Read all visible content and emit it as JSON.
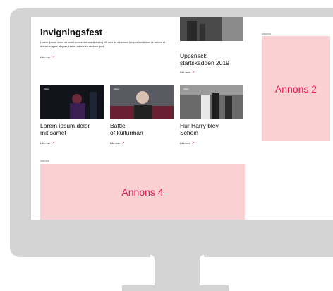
{
  "article": {
    "title": "Invigningsfest",
    "intro": "Lorem ipsum dolor sit amet consectetur adipiscing elit sed do eiusmod tempor incididunt ut labore et dolore magna aliqua ut enim ad minim veniam quis",
    "read_more": "Läs mer"
  },
  "cards": [
    {
      "title_line1": "Uppsnack",
      "title_line2": "startskadden 2019",
      "read_more": "Läs mer"
    },
    {
      "title_line1": "Lorem ipsum dolor",
      "title_line2": "mit samet",
      "read_more": "Läs mer",
      "tag": "Video"
    },
    {
      "title_line1": "Battle",
      "title_line2": "of kulturmän",
      "read_more": "Läs mer",
      "tag": "Video"
    },
    {
      "title_line1": "Hur Harry blev",
      "title_line2": "Schein",
      "read_more": "Läs mer",
      "tag": "Video"
    }
  ],
  "ads": {
    "side_label": "ANNONS",
    "side": "Annons 2",
    "bottom_label": "ANNONS",
    "bottom": "Annons 4"
  },
  "colors": {
    "accent": "#e8194d",
    "ad_bg": "#fad0d3",
    "monitor": "#d4d4d4"
  }
}
